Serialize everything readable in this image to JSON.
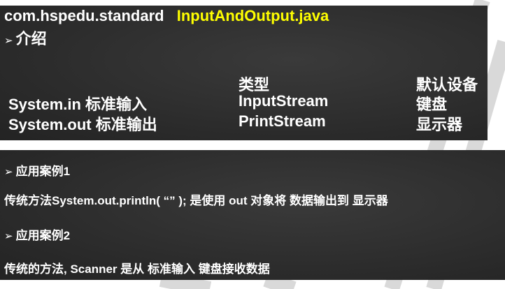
{
  "header": {
    "package": "com.hspedu.standard",
    "file": "InputAndOutput.java"
  },
  "intro": {
    "bullet": "➢",
    "label": "介绍"
  },
  "table": {
    "headers": [
      "",
      "类型",
      "默认设备"
    ],
    "rows": [
      [
        "System.in 标准输入",
        "InputStream",
        "键盘"
      ],
      [
        "System.out 标准输出",
        "PrintStream",
        "显示器"
      ]
    ]
  },
  "cases": [
    {
      "bullet": "➢",
      "title": "应用案例1",
      "text": "传统方法System.out.println( “” ); 是使用 out 对象将 数据输出到 显示器"
    },
    {
      "bullet": "➢",
      "title": "应用案例2",
      "text": "传统的方法, Scanner 是从 标准输入 键盘接收数据"
    }
  ],
  "colors": {
    "panel": "#2c2c2c",
    "text": "#ffffff",
    "highlight": "#ffff00"
  }
}
